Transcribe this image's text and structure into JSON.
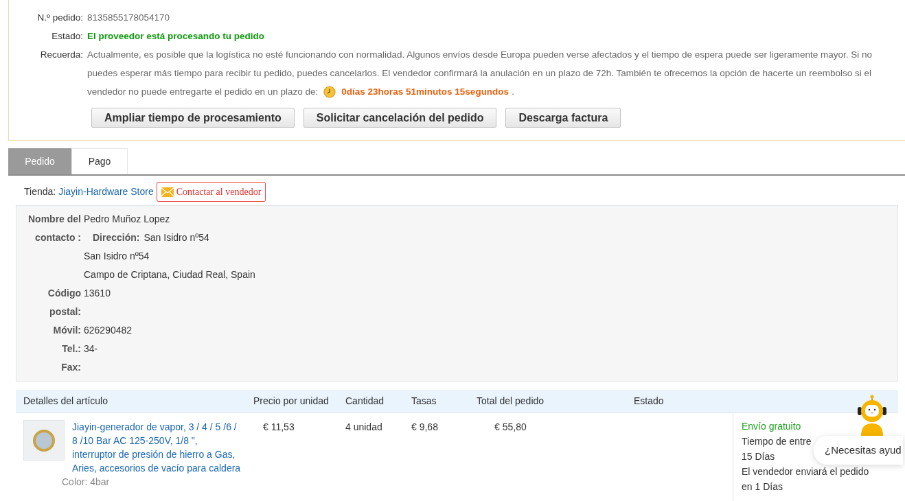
{
  "order_info": {
    "fields": [
      {
        "label": "N.º pedido:",
        "value": "8135855178054170",
        "kind": "plain"
      },
      {
        "label": "Estado:",
        "value": "El proveedor está procesando tu pedido",
        "kind": "status"
      }
    ],
    "reminder": {
      "label": "Recuerda:",
      "lines": [
        "Actualmente, es posible que la logística no esté funcionando con normalidad. Algunos envíos desde Europa pueden verse afectados y el tiempo de espera puede ser ligeramente mayor. Si no",
        "puedes esperar más tiempo para recibir tu pedido, puedes cancelarlos. El vendedor confirmará la anulación en un plazo de 72h. También te ofrecemos la opción de hacerte un reembolso si el",
        "vendedor no puede entregarte el pedido en un plazo de:"
      ],
      "countdown": "0días 23horas 51minutos 15segundos",
      "suffix": "."
    },
    "buttons": [
      "Ampliar tiempo de procesamiento",
      "Solicitar cancelación del pedido",
      "Descarga factura"
    ]
  },
  "tabs": [
    {
      "label": "Pedido",
      "selected": true
    },
    {
      "label": "Pago",
      "selected": false
    }
  ],
  "store": {
    "label": "Tienda:",
    "name": "Jiayin-Hardware Store",
    "contact_button": "Contactar al vendedor"
  },
  "address": {
    "rows": [
      {
        "label": "Nombre del contacto :",
        "lines": [
          "Pedro Muñoz Lopez"
        ],
        "sub_label": "Dirección:",
        "sub_lines": [
          "San Isidro nº54",
          "San Isidro nº54",
          "Campo de Criptana, Ciudad Real, Spain"
        ]
      },
      {
        "label": "Código postal:",
        "lines": [
          "13610"
        ]
      },
      {
        "label": "Móvil:",
        "lines": [
          "626290482"
        ]
      },
      {
        "label": "Tel.:",
        "lines": [
          "34-"
        ]
      },
      {
        "label": "Fax:",
        "lines": []
      }
    ]
  },
  "table": {
    "columns": [
      "Detalles del artículo",
      "Precio por unidad",
      "Cantidad",
      "Tasas",
      "Total del pedido",
      "Estado"
    ],
    "rows": [
      {
        "title": "Jiayin-generador de vapor, 3 / 4 / 5 /6 / 8 /10 Bar AC 125-250V, 1/8 \", interruptor de presión de hierro a Gas, Aries, accesorios de vacío para caldera",
        "variant": "Color: 4bar",
        "price": "€ 11,53",
        "quantity": "4 unidad",
        "tax": "€ 9,68",
        "total": "€ 55,80",
        "shipping": {
          "free": "Envío gratuito",
          "lines": [
            "Tiempo de entre",
            "15 Días",
            "El vendedor enviará el pedido",
            "en 1 Días"
          ]
        }
      }
    ]
  },
  "chat": {
    "bubble": "¿Necesitas ayud"
  }
}
